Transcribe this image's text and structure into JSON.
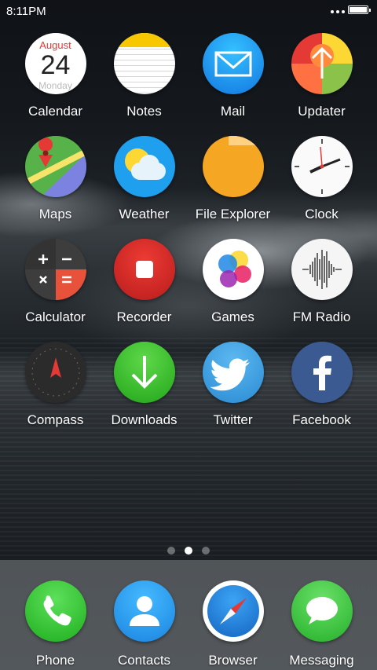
{
  "status": {
    "time": "8:11PM"
  },
  "apps": [
    {
      "label": "Calendar",
      "month": "August",
      "day": "24",
      "weekday": "Monday",
      "icon": "calendar-icon"
    },
    {
      "label": "Notes",
      "icon": "notes-icon"
    },
    {
      "label": "Mail",
      "icon": "mail-icon"
    },
    {
      "label": "Updater",
      "icon": "updater-icon"
    },
    {
      "label": "Maps",
      "icon": "maps-icon"
    },
    {
      "label": "Weather",
      "icon": "weather-icon"
    },
    {
      "label": "File Explorer",
      "icon": "folder-icon"
    },
    {
      "label": "Clock",
      "icon": "clock-icon"
    },
    {
      "label": "Calculator",
      "icon": "calculator-icon"
    },
    {
      "label": "Recorder",
      "icon": "recorder-icon"
    },
    {
      "label": "Games",
      "icon": "games-icon"
    },
    {
      "label": "FM Radio",
      "icon": "radio-icon"
    },
    {
      "label": "Compass",
      "icon": "compass-icon"
    },
    {
      "label": "Downloads",
      "icon": "download-icon"
    },
    {
      "label": "Twitter",
      "icon": "twitter-icon"
    },
    {
      "label": "Facebook",
      "icon": "facebook-icon"
    }
  ],
  "pager": {
    "count": 3,
    "active_index": 1
  },
  "dock": [
    {
      "label": "Phone",
      "icon": "phone-icon"
    },
    {
      "label": "Contacts",
      "icon": "contacts-icon"
    },
    {
      "label": "Browser",
      "icon": "browser-icon"
    },
    {
      "label": "Messaging",
      "icon": "messaging-icon"
    }
  ],
  "colors": {
    "mail": "#1e9ef0",
    "maps": "#4caf50",
    "folder": "#f5a623",
    "recorder": "#d32f2f",
    "downloads": "#3cbf2d",
    "twitter": "#3a9be0",
    "facebook": "#3b5a92",
    "phone": "#2ec52e",
    "contacts": "#1d9ef2",
    "messaging": "#37c83a"
  }
}
